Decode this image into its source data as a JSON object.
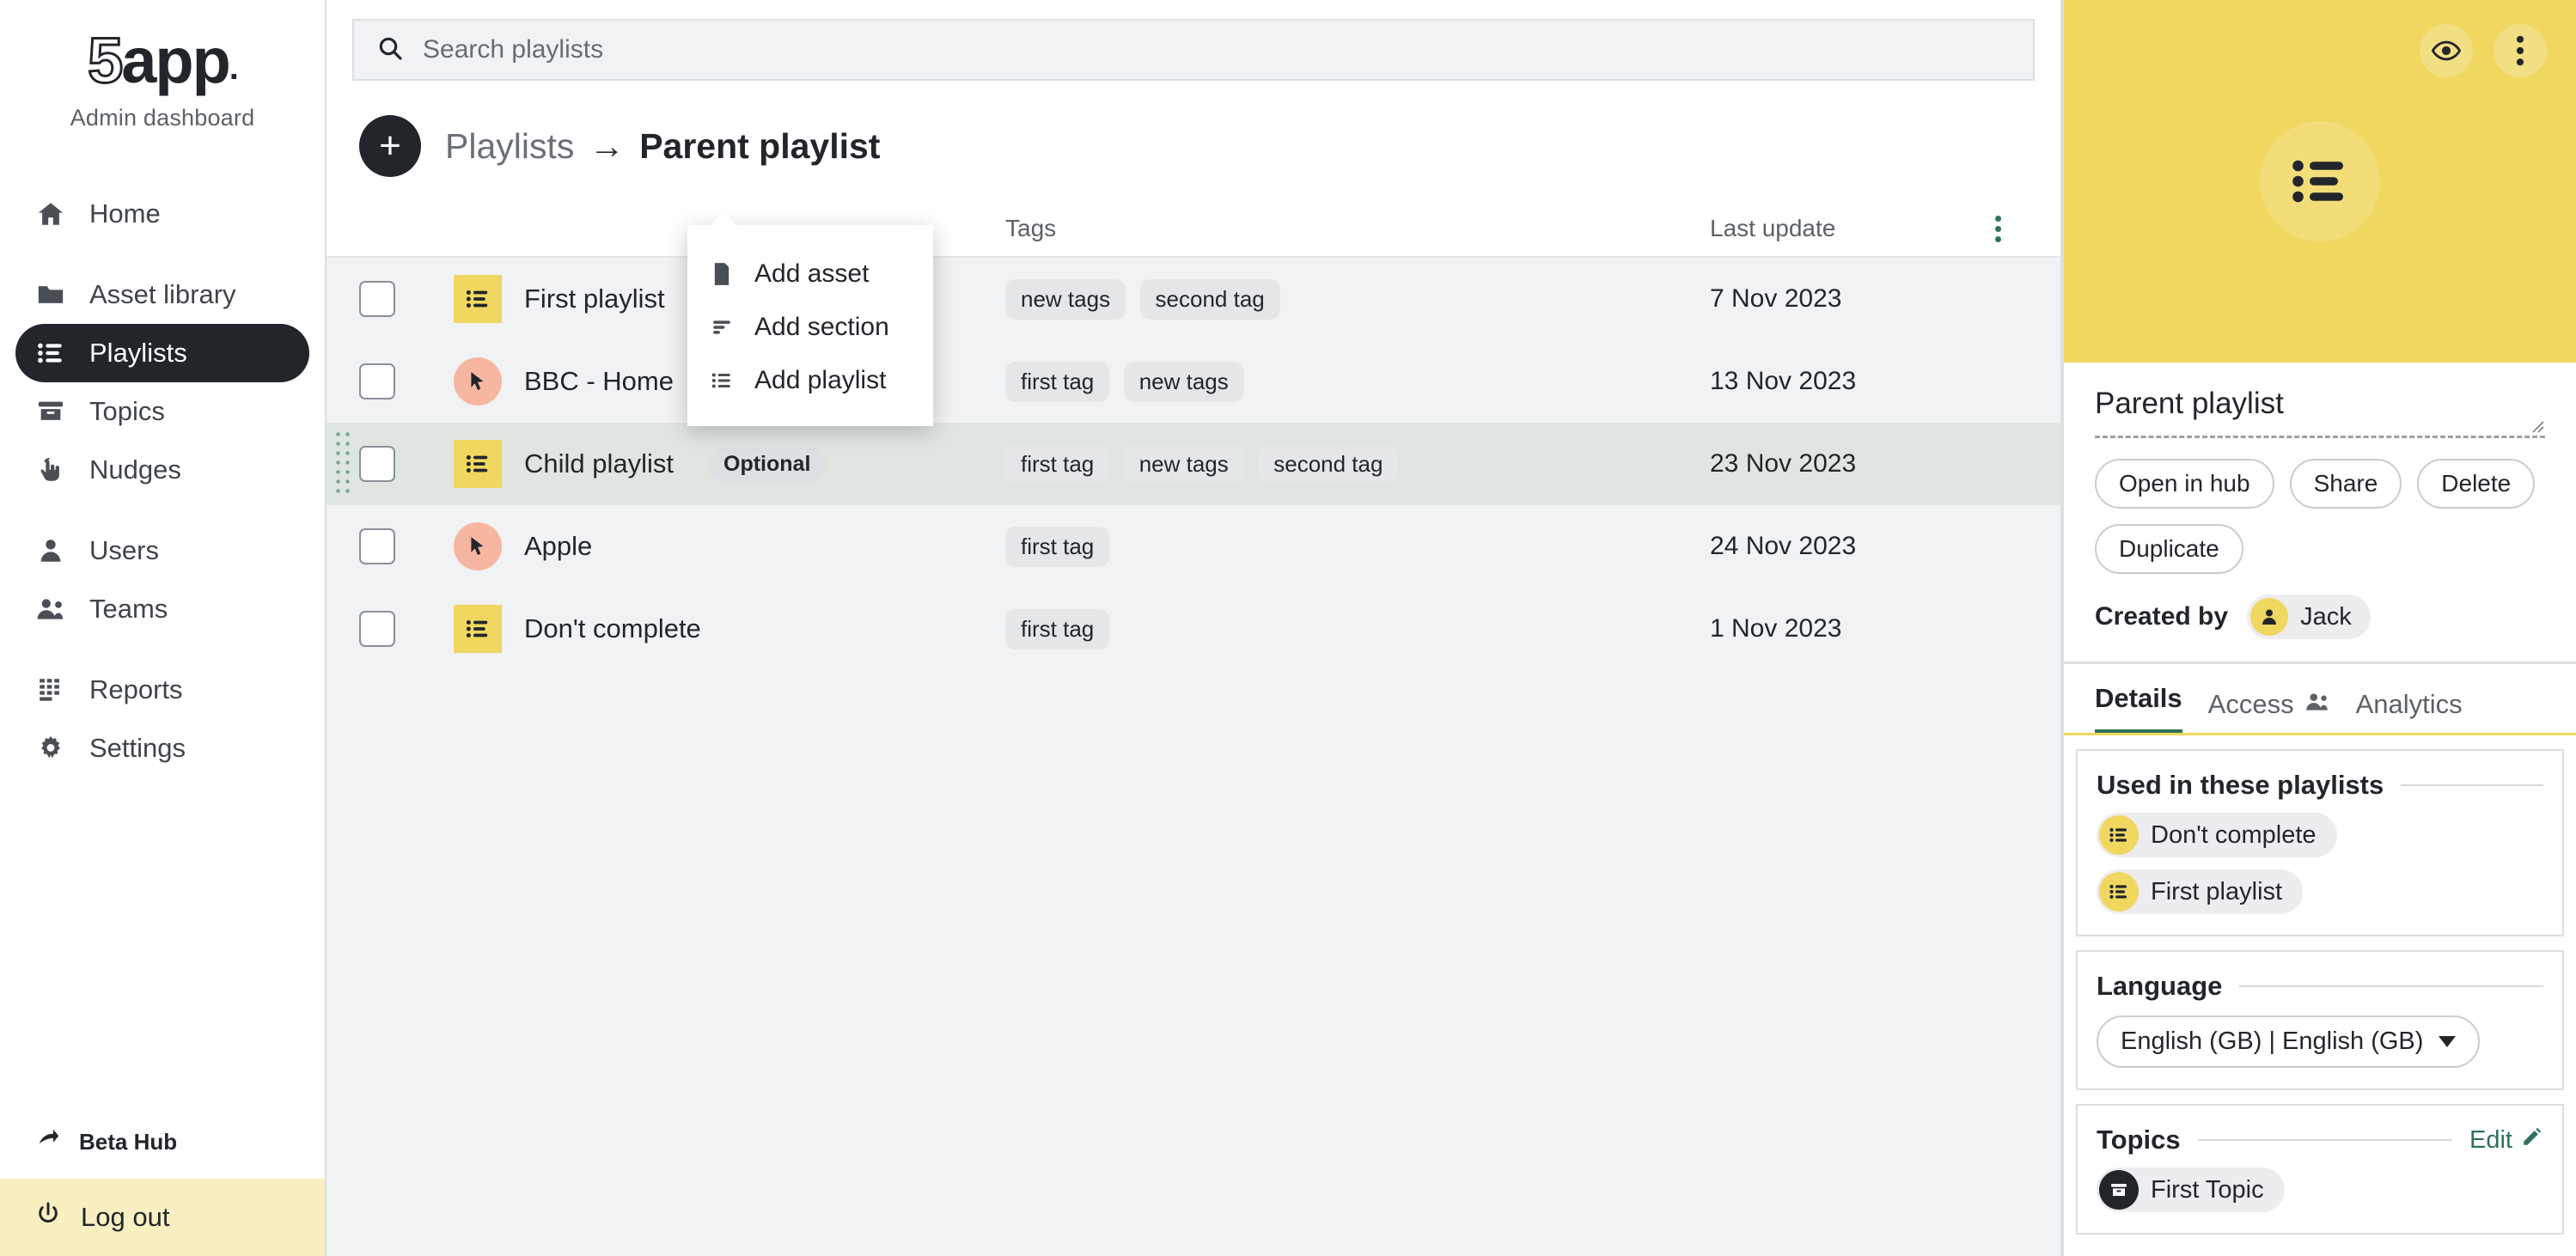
{
  "brand": {
    "logo_five": "5",
    "logo_rest": "app",
    "logo_dot": ".",
    "subtitle": "Admin dashboard"
  },
  "sidebar": {
    "items": [
      {
        "label": "Home",
        "icon": "home-icon",
        "active": false
      },
      {
        "label": "Asset library",
        "icon": "folder-icon",
        "active": false
      },
      {
        "label": "Playlists",
        "icon": "list-icon",
        "active": true
      },
      {
        "label": "Topics",
        "icon": "archive-icon",
        "active": false
      },
      {
        "label": "Nudges",
        "icon": "hand-pointer-icon",
        "active": false
      },
      {
        "label": "Users",
        "icon": "user-icon",
        "active": false
      },
      {
        "label": "Teams",
        "icon": "users-icon",
        "active": false
      },
      {
        "label": "Reports",
        "icon": "grid-icon",
        "active": false
      },
      {
        "label": "Settings",
        "icon": "gear-icon",
        "active": false
      }
    ],
    "beta_hub": "Beta Hub",
    "logout": "Log out"
  },
  "search": {
    "placeholder": "Search playlists"
  },
  "breadcrumb": {
    "root": "Playlists",
    "arrow": "→",
    "current": "Parent playlist"
  },
  "add_menu": {
    "items": [
      {
        "label": "Add asset",
        "icon": "document-icon"
      },
      {
        "label": "Add section",
        "icon": "section-icon"
      },
      {
        "label": "Add playlist",
        "icon": "list-icon"
      }
    ]
  },
  "table": {
    "headers": {
      "name": "",
      "tags": "Tags",
      "last_update": "Last update"
    },
    "rows": [
      {
        "name": "First playlist",
        "badge": "",
        "thumb": "playlist-thumb",
        "tags": [
          "new tags",
          "second tag"
        ],
        "last_update": "7 Nov 2023",
        "selected": false,
        "checked": false
      },
      {
        "name": "BBC - Home",
        "badge": "",
        "thumb": "link-thumb",
        "tags": [
          "first tag",
          "new tags"
        ],
        "last_update": "13 Nov 2023",
        "selected": false,
        "checked": false
      },
      {
        "name": "Child playlist",
        "badge": "Optional",
        "thumb": "playlist-thumb",
        "tags": [
          "first tag",
          "new tags",
          "second tag"
        ],
        "last_update": "23 Nov 2023",
        "selected": true,
        "checked": false
      },
      {
        "name": "Apple",
        "badge": "",
        "thumb": "link-thumb",
        "tags": [
          "first tag"
        ],
        "last_update": "24 Nov 2023",
        "selected": false,
        "checked": false
      },
      {
        "name": "Don't complete",
        "badge": "",
        "thumb": "playlist-thumb",
        "tags": [
          "first tag"
        ],
        "last_update": "1 Nov 2023",
        "selected": false,
        "checked": false
      }
    ]
  },
  "panel": {
    "hero_color": "#f0d760",
    "title": "Parent playlist",
    "actions": [
      "Open in hub",
      "Share",
      "Delete",
      "Duplicate"
    ],
    "created_by_label": "Created by",
    "created_by_user": "Jack",
    "tabs": [
      {
        "label": "Details",
        "active": true
      },
      {
        "label": "Access",
        "active": false
      },
      {
        "label": "Analytics",
        "active": false
      }
    ],
    "used_in": {
      "title": "Used in these playlists",
      "items": [
        "Don't complete",
        "First playlist"
      ]
    },
    "language": {
      "title": "Language",
      "value": "English (GB) | English (GB)"
    },
    "topics": {
      "title": "Topics",
      "edit": "Edit",
      "items": [
        "First Topic"
      ]
    }
  },
  "colors": {
    "accent_yellow": "#f0d760",
    "accent_green": "#2e7357",
    "dark": "#22262b",
    "selected_row": "#dfe6e2",
    "link_thumb": "#f6b6a0"
  }
}
